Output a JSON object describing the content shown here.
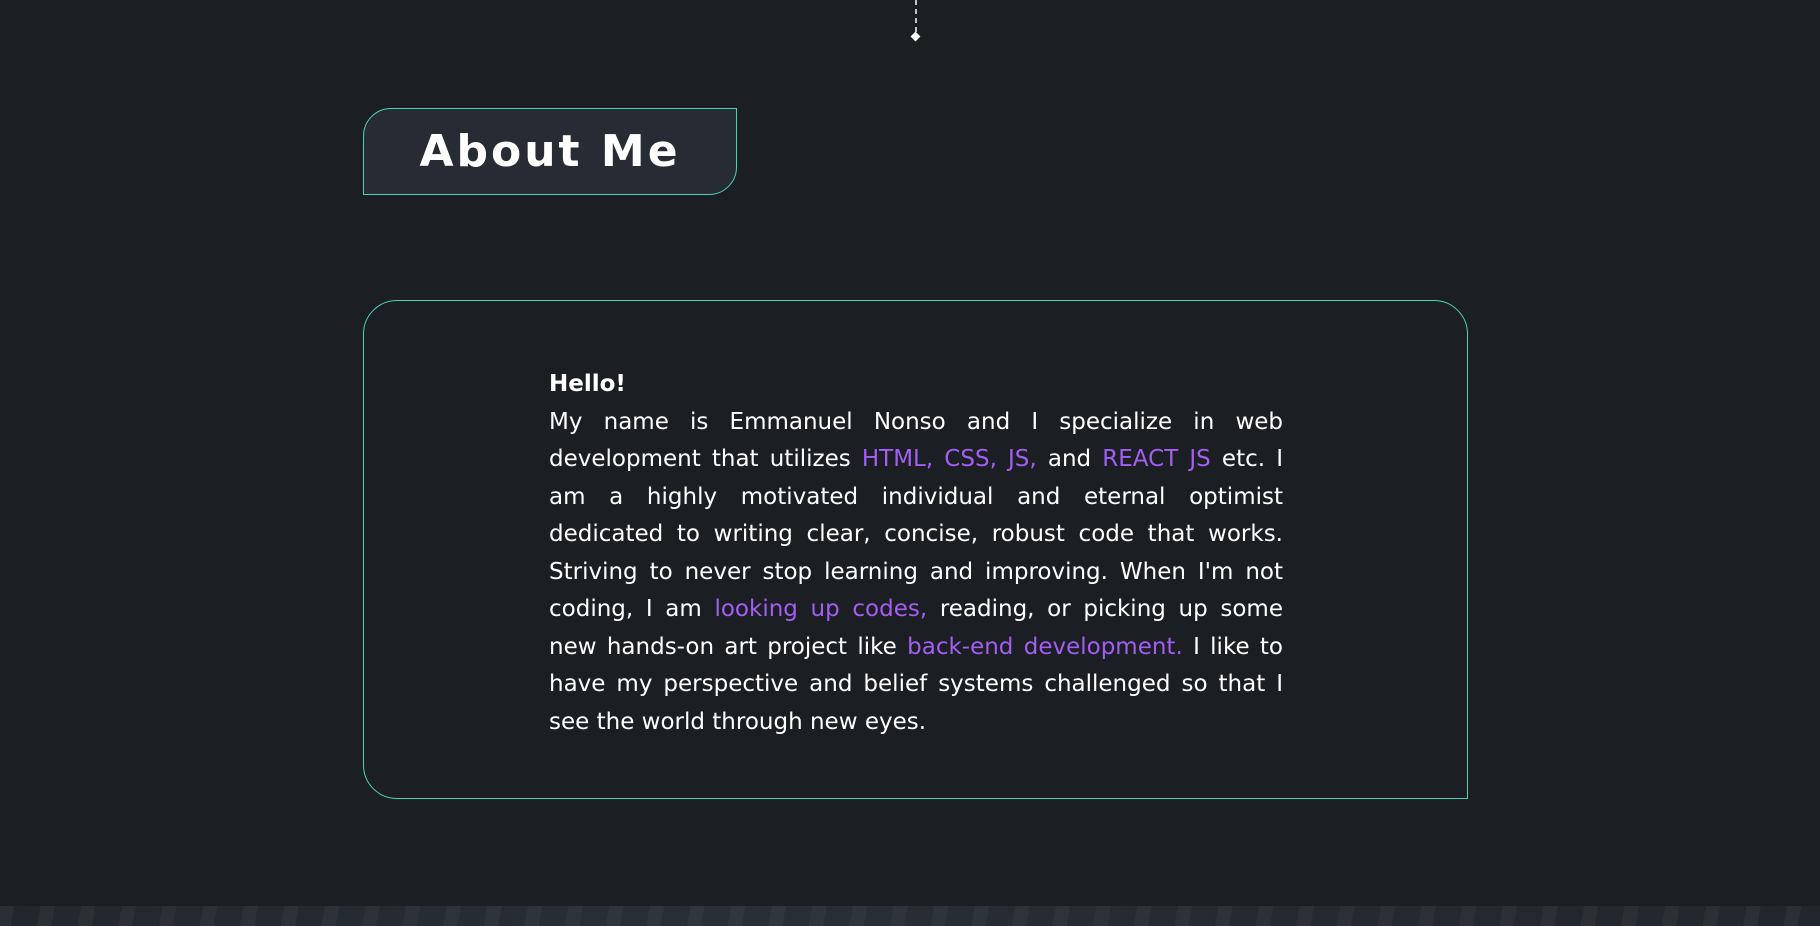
{
  "section": {
    "title": "About Me"
  },
  "about": {
    "greeting": "Hello!",
    "segments": {
      "s1": "My name is Emmanuel Nonso and I specialize in web development that utilizes ",
      "a1": "HTML, CSS, JS,",
      "s2": " and ",
      "a2": "REACT JS",
      "s3": " etc. I am a highly motivated individual and eternal optimist dedicated to writing clear, concise, robust code that works. Striving to never stop learning and improving. When I'm not coding, I am ",
      "a3": "looking up codes,",
      "s4": " reading, or picking up some new hands-on art project like ",
      "a4": "back-end development.",
      "s5": " I like to have my perspective and belief systems challenged so that I see the world through new eyes."
    }
  },
  "colors": {
    "background": "#1b1e23",
    "accent_border": "#4fd1b8",
    "accent_text": "#a35ef2",
    "badge_fill": "#272c34"
  }
}
